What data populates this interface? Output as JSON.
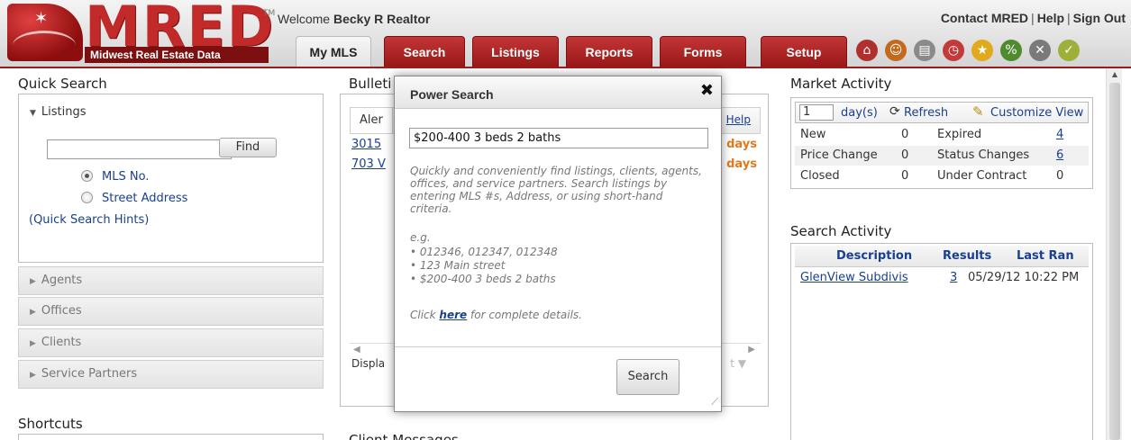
{
  "header": {
    "logo_text": "MRED",
    "logo_tm": "TM",
    "logo_subtitle": "Midwest Real Estate Data",
    "welcome_prefix": "Welcome",
    "user_name": "Becky R Realtor",
    "links": [
      "Contact MRED",
      "Help",
      "Sign Out"
    ],
    "tabs": [
      "My MLS",
      "Search",
      "Listings",
      "Reports",
      "Forms",
      "Setup"
    ],
    "active_tab": "My MLS",
    "icons": [
      "home-icon",
      "people-icon",
      "documents-icon",
      "clock-icon",
      "star-icon",
      "percent-icon",
      "tools-icon",
      "check-icon"
    ]
  },
  "quick_search": {
    "title": "Quick Search",
    "listings_label": "Listings",
    "input_value": "",
    "find_label": "Find",
    "radio_options": [
      "MLS No.",
      "Street Address"
    ],
    "selected_option": "MLS No.",
    "hints_link": "(Quick Search Hints)",
    "accordions": [
      "Agents",
      "Offices",
      "Clients",
      "Service Partners"
    ]
  },
  "shortcuts": {
    "title": "Shortcuts"
  },
  "bulletin": {
    "title_visible": "Bulleti",
    "tab_visible": "Aler",
    "help_link": "Help",
    "rows": [
      {
        "link": "3015",
        "days": "days"
      },
      {
        "link": "703 V",
        "days": "days"
      }
    ],
    "display_text": "Displa",
    "scroll_hint": "t ▼"
  },
  "client_messages": {
    "title_visible": "Client Messages"
  },
  "market_activity": {
    "title": "Market Activity",
    "days_value": "1",
    "days_label": "day(s)",
    "refresh_label": "Refresh",
    "customize_label": "Customize View",
    "rows": [
      {
        "left_label": "New",
        "left_value": "0",
        "right_label": "Expired",
        "right_value": "4",
        "right_link": true
      },
      {
        "left_label": "Price Change",
        "left_value": "0",
        "right_label": "Status Changes",
        "right_value": "6",
        "right_link": true
      },
      {
        "left_label": "Closed",
        "left_value": "0",
        "right_label": "Under Contract",
        "right_value": "0",
        "right_link": false
      }
    ]
  },
  "search_activity": {
    "title": "Search Activity",
    "columns": [
      "Description",
      "Results",
      "Last Ran"
    ],
    "rows": [
      {
        "description": "GlenView Subdivis",
        "results": "3",
        "last_ran": "05/29/12 10:22 PM"
      }
    ]
  },
  "power_search": {
    "title": "Power Search",
    "close_icon": "close-icon",
    "input_value": "$200-400 3 beds 2 baths",
    "description": "Quickly and conveniently find listings, clients, agents, offices, and service partners. Search listings by entering MLS #s, Address, or using short-hand criteria.",
    "eg_label": "e.g.",
    "examples": [
      "012346, 012347, 012348",
      "123 Main street",
      "$200-400 3 beds 2 baths"
    ],
    "click_prefix": "Click",
    "click_link": "here",
    "click_suffix": "for complete details.",
    "search_button": "Search"
  },
  "colors": {
    "brand_red": "#b82525",
    "link_blue": "#1a3f8f",
    "days_orange": "#e07a1d"
  }
}
